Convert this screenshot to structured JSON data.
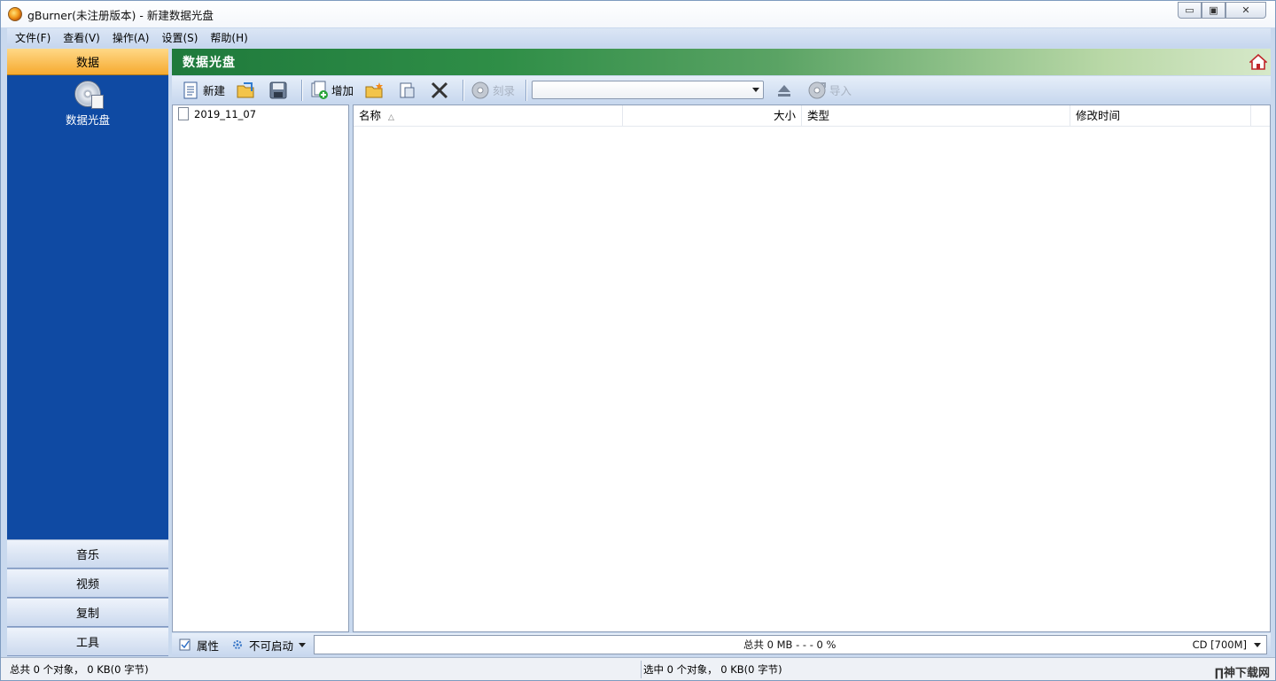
{
  "window": {
    "title": "gBurner(未注册版本) - 新建数据光盘",
    "controls": {
      "minimize": "▭",
      "restore": "▣",
      "close": "✕"
    }
  },
  "menu": [
    "文件(F)",
    "查看(V)",
    "操作(A)",
    "设置(S)",
    "帮助(H)"
  ],
  "nav": {
    "active": "数据",
    "project": "数据光盘",
    "tabs": [
      "音乐",
      "视频",
      "复制",
      "工具"
    ]
  },
  "section": {
    "title": "数据光盘"
  },
  "toolbar": {
    "new_label": "新建",
    "add_label": "增加",
    "burn_label": "刻录",
    "import_label": "导入",
    "drive_value": ""
  },
  "tree": {
    "item": "2019_11_07"
  },
  "columns": {
    "name": "名称",
    "size": "大小",
    "type": "类型",
    "modified": "修改时间"
  },
  "bottom": {
    "properties_label": "属性",
    "boot_label": "不可启动",
    "capacity_text": "总共 0 MB   - - -  0 %",
    "disc_type": "CD [700M]"
  },
  "status": {
    "left": "总共 0 个对象， 0 KB(0 字节)",
    "right": "选中 0 个对象， 0 KB(0 字节)"
  },
  "watermark": "∏神下载网",
  "colors": {
    "nav_bg": "#0f4aa3",
    "active_tab": "#f6aa2f",
    "section_green": "#2f8e47"
  }
}
